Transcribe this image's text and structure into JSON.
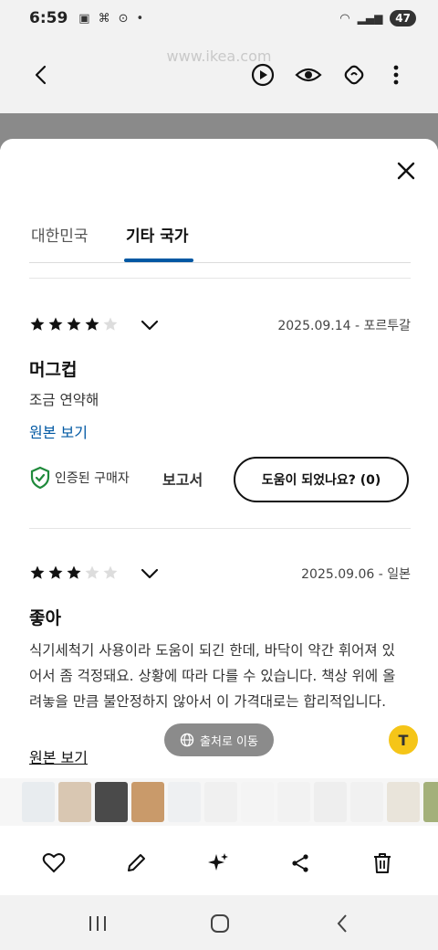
{
  "status_bar": {
    "time": "6:59",
    "battery": "47"
  },
  "browser": {
    "url": "www.ikea.com"
  },
  "sheet": {
    "tabs": [
      {
        "label": "대한민국",
        "active": false
      },
      {
        "label": "기타 국가",
        "active": true
      }
    ],
    "reviews": [
      {
        "rating": 4,
        "max_rating": 5,
        "date_country": "2025.09.14 - 포르투갈",
        "title": "머그컵",
        "body": "조금 연약해",
        "view_original": "원본 보기",
        "verified": "인증된 구매자",
        "report": "보고서",
        "helpful": "도움이 되었나요? (0)"
      },
      {
        "rating": 3,
        "max_rating": 5,
        "date_country": "2025.09.06 - 일본",
        "title": "좋아",
        "body": "식기세척기 사용이라 도움이 되긴 한데, 바닥이 약간 휘어져 있어서 좀 걱정돼요. 상황에 따라 다를 수 있습니다. 책상 위에 올려놓을 만큼 불안정하지 않아서 이 가격대로는 합리적입니다.",
        "view_original": "원본 보기"
      }
    ]
  },
  "overlay": {
    "goto_source": "출처로 이동",
    "translate_label": "T"
  },
  "thumb_strip": {
    "colors": [
      "#e8ecef",
      "#d9c7b2",
      "#4a4a4a",
      "#c99a6a",
      "#eef0f2",
      "#f0f0f0",
      "#f4f4f4",
      "#f2f2f2",
      "#eeeeee",
      "#f1f1f1",
      "#e9e4da",
      "#a3b07a",
      "#d6dcea",
      "#7a8a6a"
    ]
  },
  "colors": {
    "accent": "#0058a3",
    "verified_green": "#1f8a3b",
    "star": "#111111",
    "star_empty": "#dddddd"
  }
}
